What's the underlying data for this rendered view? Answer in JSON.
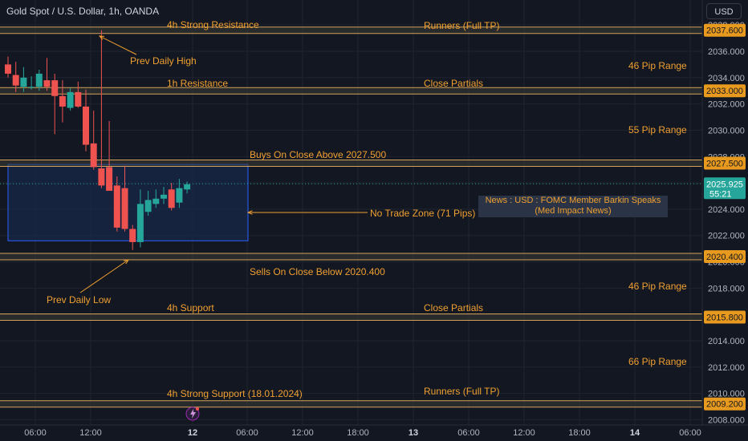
{
  "header": {
    "symbol": "Gold Spot / U.S. Dollar, 1h, OANDA",
    "currency_label": "USD"
  },
  "colors": {
    "background": "#131722",
    "grid": "#1f2430",
    "bull": "#26a69a",
    "bear": "#ef5350",
    "level_line": "#d1a35a",
    "annotation": "#f0a030",
    "zone_fill": "#17284a",
    "zone_border": "#2962ff",
    "last_price_bg": "#26a69a",
    "level_label_bg": "#e89a1e"
  },
  "news": {
    "line1": "News : USD : FOMC Member Barkin Speaks",
    "line2": "(Med Impact News)"
  },
  "chart_data": {
    "type": "candlestick",
    "x_ticks": [
      "06:00",
      "12:00",
      "12",
      "06:00",
      "12:00",
      "18:00",
      "13",
      "06:00",
      "12:00",
      "18:00",
      "14",
      "06:00"
    ],
    "y_ticks": [
      "2038.000",
      "2036.000",
      "2034.000",
      "2032.000",
      "2030.000",
      "2028.000",
      "2026.000",
      "2024.000",
      "2022.000",
      "2020.000",
      "2018.000",
      "2016.000",
      "2014.000",
      "2012.000",
      "2010.000",
      "2008.000"
    ],
    "y_tick_values": [
      2038,
      2036,
      2034,
      2032,
      2030,
      2028,
      2026,
      2024,
      2022,
      2020,
      2018,
      2016,
      2014,
      2012,
      2010,
      2008
    ],
    "ylim": [
      2007.6,
      2039.9
    ],
    "candles": [
      {
        "o": 2035.0,
        "h": 2035.6,
        "l": 2034.0,
        "c": 2034.3
      },
      {
        "o": 2034.2,
        "h": 2035.2,
        "l": 2032.9,
        "c": 2033.4
      },
      {
        "o": 2033.3,
        "h": 2034.8,
        "l": 2032.9,
        "c": 2034.0
      },
      {
        "o": 2033.3,
        "h": 2034.1,
        "l": 2033.1,
        "c": 2033.3
      },
      {
        "o": 2033.3,
        "h": 2034.6,
        "l": 2033.0,
        "c": 2034.3
      },
      {
        "o": 2033.8,
        "h": 2035.5,
        "l": 2033.0,
        "c": 2033.3
      },
      {
        "o": 2033.8,
        "h": 2034.3,
        "l": 2029.7,
        "c": 2032.6
      },
      {
        "o": 2032.6,
        "h": 2033.8,
        "l": 2030.6,
        "c": 2031.8
      },
      {
        "o": 2031.7,
        "h": 2033.2,
        "l": 2031.5,
        "c": 2032.9
      },
      {
        "o": 2032.9,
        "h": 2033.7,
        "l": 2031.7,
        "c": 2031.8
      },
      {
        "o": 2031.8,
        "h": 2033.1,
        "l": 2028.4,
        "c": 2028.9
      },
      {
        "o": 2029.0,
        "h": 2031.5,
        "l": 2027.0,
        "c": 2027.2
      },
      {
        "o": 2027.1,
        "h": 2037.6,
        "l": 2025.6,
        "c": 2025.8
      },
      {
        "o": 2027.2,
        "h": 2030.7,
        "l": 2025.6,
        "c": 2025.4
      },
      {
        "o": 2025.8,
        "h": 2026.5,
        "l": 2022.3,
        "c": 2022.6
      },
      {
        "o": 2025.6,
        "h": 2027.3,
        "l": 2022.3,
        "c": 2022.5
      },
      {
        "o": 2022.5,
        "h": 2022.8,
        "l": 2020.9,
        "c": 2021.5
      },
      {
        "o": 2021.5,
        "h": 2025.5,
        "l": 2021.1,
        "c": 2024.4
      },
      {
        "o": 2023.8,
        "h": 2025.4,
        "l": 2023.5,
        "c": 2024.7
      },
      {
        "o": 2024.4,
        "h": 2025.5,
        "l": 2024.1,
        "c": 2024.8
      },
      {
        "o": 2024.8,
        "h": 2025.7,
        "l": 2024.4,
        "c": 2025.1
      },
      {
        "o": 2025.5,
        "h": 2026.0,
        "l": 2023.9,
        "c": 2024.1
      },
      {
        "o": 2024.5,
        "h": 2026.3,
        "l": 2024.1,
        "c": 2025.6
      },
      {
        "o": 2025.5,
        "h": 2026.1,
        "l": 2025.2,
        "c": 2025.9
      }
    ],
    "levels": [
      {
        "value": 2037.6,
        "label": "2037.600"
      },
      {
        "value": 2033.0,
        "label": "2033.000"
      },
      {
        "value": 2027.5,
        "label": "2027.500"
      },
      {
        "value": 2020.4,
        "label": "2020.400"
      },
      {
        "value": 2015.8,
        "label": "2015.800"
      },
      {
        "value": 2009.2,
        "label": "2009.200"
      }
    ],
    "last_price": {
      "value": 2025.925,
      "label": "2025.925",
      "countdown": "55:21"
    },
    "no_trade_zone": {
      "top": 2027.4,
      "bottom": 2021.6
    },
    "annotations": {
      "strong_resistance": "4h Strong Resistance",
      "runners_top": "Runners (Full TP)",
      "prev_daily_high": "Prev Daily High",
      "range_46_top": "46 Pip Range",
      "resistance_1h": "1h Resistance",
      "close_partials_top": "Close Partials",
      "range_55": "55 Pip Range",
      "buys_above": "Buys On Close Above 2027.500",
      "no_trade_zone": "No Trade Zone (71 Pips)",
      "sells_below": "Sells On Close Below 2020.400",
      "range_46_bottom": "46 Pip Range",
      "prev_daily_low": "Prev Daily Low",
      "support_4h": "4h Support",
      "close_partials_bottom": "Close Partials",
      "range_66": "66 Pip Range",
      "strong_support": "4h Strong Support (18.01.2024)",
      "runners_bottom": "Runners (Full TP)"
    }
  }
}
